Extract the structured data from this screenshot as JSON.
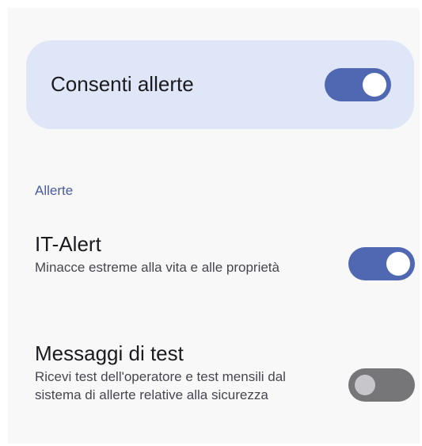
{
  "master": {
    "label": "Consenti allerte",
    "enabled": true
  },
  "section": {
    "header": "Allerte"
  },
  "settings": [
    {
      "title": "IT-Alert",
      "description": "Minacce estreme alla vita e alle proprietà",
      "enabled": true
    },
    {
      "title": "Messaggi di test",
      "description": "Ricevi test dell'operatore e test mensili dal sistema di allerte relative alla sicurezza",
      "enabled": false
    }
  ],
  "colors": {
    "accent": "#5068b1",
    "card_background": "#dfe6f8",
    "section_header": "#4a5c9c",
    "toggle_off": "#767679"
  }
}
